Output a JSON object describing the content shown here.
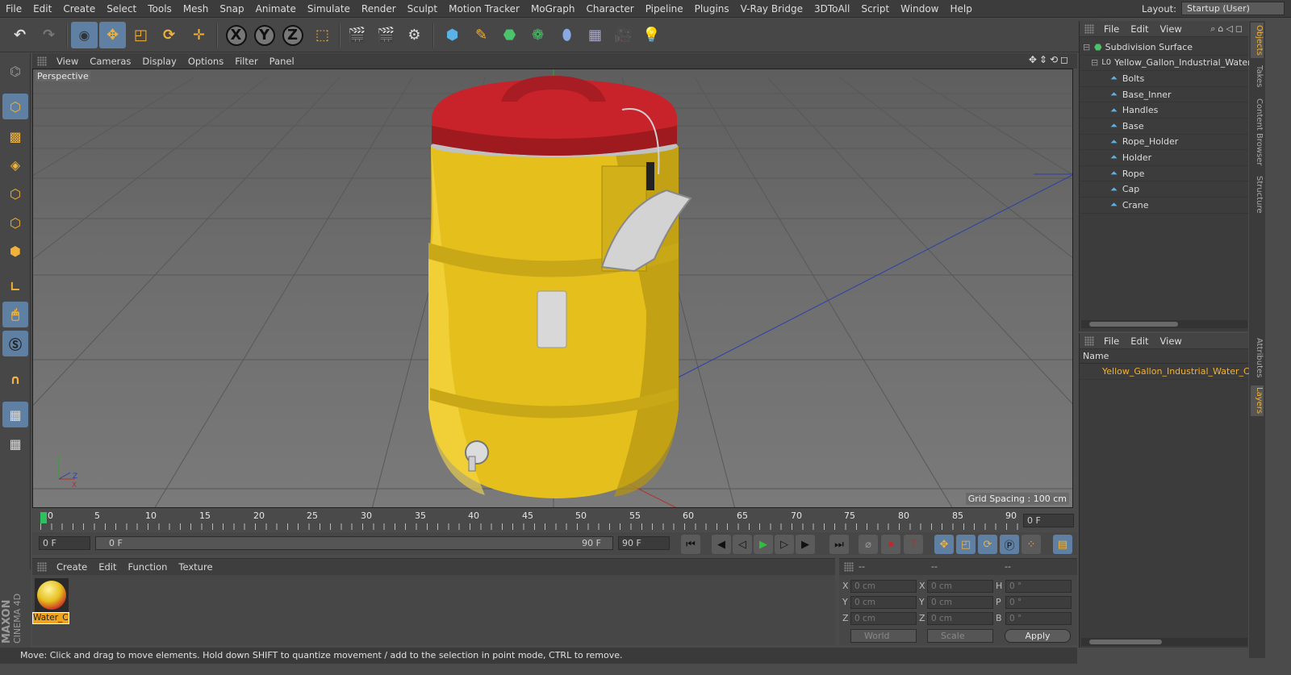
{
  "menu": [
    "File",
    "Edit",
    "Create",
    "Select",
    "Tools",
    "Mesh",
    "Snap",
    "Animate",
    "Simulate",
    "Render",
    "Sculpt",
    "Motion Tracker",
    "MoGraph",
    "Character",
    "Pipeline",
    "Plugins",
    "V-Ray Bridge",
    "3DToAll",
    "Script",
    "Window",
    "Help"
  ],
  "layout": {
    "label": "Layout:",
    "value": "Startup (User)"
  },
  "viewport": {
    "menu": [
      "View",
      "Cameras",
      "Display",
      "Options",
      "Filter",
      "Panel"
    ],
    "label": "Perspective",
    "grid_spacing": "Grid Spacing : 100 cm"
  },
  "timeline": {
    "ticks": [
      "0",
      "5",
      "10",
      "15",
      "20",
      "25",
      "30",
      "35",
      "40",
      "45",
      "50",
      "55",
      "60",
      "65",
      "70",
      "75",
      "80",
      "85",
      "90"
    ],
    "end_frame_field": "0 F",
    "current_field": "0 F",
    "range_start": "0 F",
    "range_end_label": "90 F",
    "max_field": "90 F"
  },
  "material": {
    "menu": [
      "Create",
      "Edit",
      "Function",
      "Texture"
    ],
    "name": "Water_C"
  },
  "coords": {
    "head1": "--",
    "head2": "--",
    "head3": "--",
    "rows": [
      {
        "a": "X",
        "av": "0 cm",
        "b": "X",
        "bv": "0 cm",
        "c": "H",
        "cv": "0 °"
      },
      {
        "a": "Y",
        "av": "0 cm",
        "b": "Y",
        "bv": "0 cm",
        "c": "P",
        "cv": "0 °"
      },
      {
        "a": "Z",
        "av": "0 cm",
        "b": "Z",
        "bv": "0 cm",
        "c": "B",
        "cv": "0 °"
      }
    ],
    "world": "World",
    "scale": "Scale",
    "apply": "Apply"
  },
  "status": "Move: Click and drag to move elements. Hold down SHIFT to quantize movement / add to the selection in point mode, CTRL to remove.",
  "objects": {
    "menu": [
      "File",
      "Edit",
      "View"
    ],
    "root": "Subdivision Surface",
    "group": "Yellow_Gallon_Industrial_Water_",
    "children": [
      "Bolts",
      "Base_Inner",
      "Handles",
      "Base",
      "Rope_Holder",
      "Holder",
      "Rope",
      "Cap",
      "Crane"
    ]
  },
  "layers": {
    "menu": [
      "File",
      "Edit",
      "View"
    ],
    "column": "Name",
    "item": "Yellow_Gallon_Industrial_Water_C"
  },
  "side_tabs": [
    "Objects",
    "Takes",
    "Content Browser",
    "Structure",
    "Attributes",
    "Layers"
  ],
  "brand": {
    "line1": "MAXON",
    "line2": "CINEMA 4D"
  },
  "colors": {
    "accent": "#f0b23a",
    "selected": "#5f7fa3",
    "body": "#e5c01d",
    "lid": "#c8232a"
  }
}
